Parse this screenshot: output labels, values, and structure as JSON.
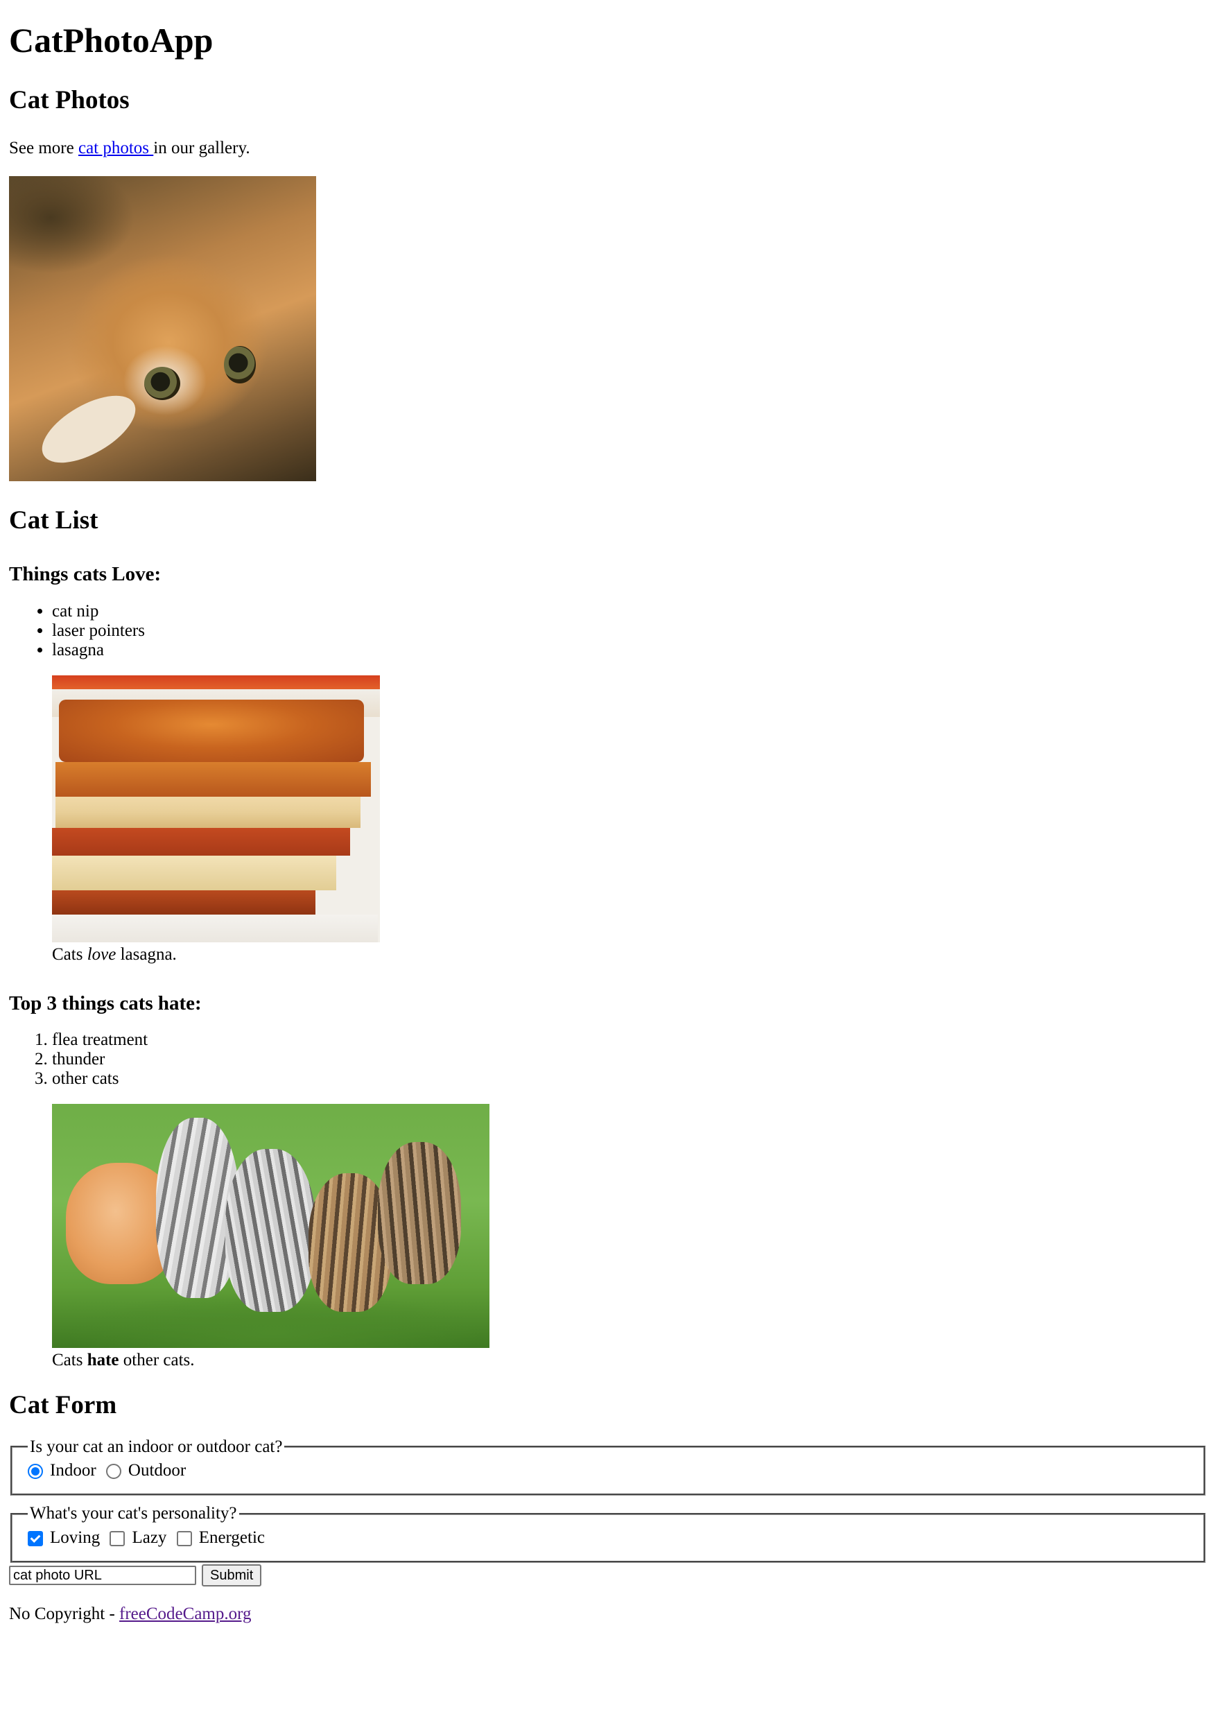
{
  "page_title": "CatPhotoApp",
  "photos_section": {
    "heading": "Cat Photos",
    "intro_prefix": "See more",
    "intro_link": "cat photos",
    "intro_suffix": "in our gallery."
  },
  "list_section": {
    "heading": "Cat List",
    "love_heading": "Things cats Love:",
    "love_items": [
      "cat nip",
      "laser pointers",
      "lasagna"
    ],
    "love_caption": {
      "prefix": "Cats",
      "emphasis": "love",
      "suffix": "lasagna."
    },
    "hate_heading": "Top 3 things cats hate:",
    "hate_items": [
      "flea treatment",
      "thunder",
      "other cats"
    ],
    "hate_numbers": [
      "1.",
      "2.",
      "3."
    ],
    "hate_caption": {
      "prefix": "Cats",
      "strong": "hate",
      "suffix": "other cats."
    }
  },
  "form_section": {
    "heading": "Cat Form",
    "location_legend": "Is your cat an indoor or outdoor cat?",
    "location_options": [
      {
        "label": "Indoor",
        "checked": true
      },
      {
        "label": "Outdoor",
        "checked": false
      }
    ],
    "personality_legend": "What's your cat's personality?",
    "personality_options": [
      {
        "label": "Loving",
        "checked": true
      },
      {
        "label": "Lazy",
        "checked": false
      },
      {
        "label": "Energetic",
        "checked": false
      }
    ],
    "url_placeholder": "cat photo URL",
    "submit_label": "Submit"
  },
  "footer": {
    "text": "No Copyright -",
    "link": "freeCodeCamp.org"
  },
  "colors": {
    "link": "#0000ee",
    "visited_link": "#551a8b",
    "control_accent": "#0075ff"
  }
}
